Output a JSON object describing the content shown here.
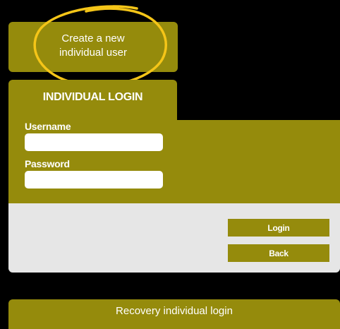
{
  "create_user": {
    "line1": "Create a new",
    "line2": "individual user"
  },
  "login": {
    "title": "INDIVIDUAL LOGIN",
    "username_label": "Username",
    "username_value": "",
    "password_label": "Password",
    "password_value": "",
    "login_button": "Login",
    "back_button": "Back"
  },
  "recovery": {
    "label": "Recovery individual login"
  },
  "colors": {
    "olive": "#958b0c",
    "highlight_ring": "#f5c518",
    "footer_gray": "#e6e6e6",
    "background": "#000000"
  }
}
